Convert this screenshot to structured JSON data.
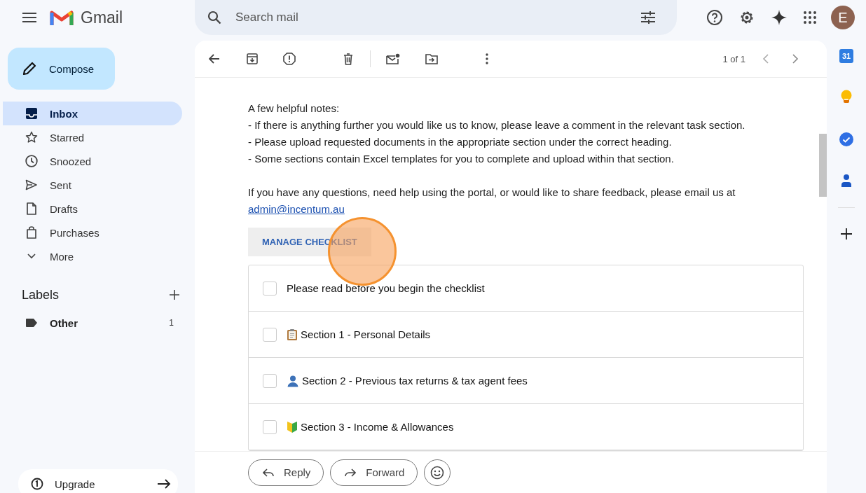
{
  "header": {
    "app_name": "Gmail",
    "search": {
      "placeholder": "Search mail"
    },
    "avatar": "E"
  },
  "compose": "Compose",
  "nav": [
    {
      "label": "Inbox",
      "kind": "inbox",
      "selected": true
    },
    {
      "label": "Starred",
      "kind": "star",
      "selected": false
    },
    {
      "label": "Snoozed",
      "kind": "clock",
      "selected": false
    },
    {
      "label": "Sent",
      "kind": "send",
      "selected": false
    },
    {
      "label": "Drafts",
      "kind": "file",
      "selected": false
    },
    {
      "label": "Purchases",
      "kind": "bag",
      "selected": false
    },
    {
      "label": "More",
      "kind": "more",
      "selected": false
    }
  ],
  "labels": {
    "title": "Labels",
    "items": [
      {
        "name": "Other",
        "count": "1"
      }
    ]
  },
  "upgrade": "Upgrade",
  "toolbar": {
    "pager": "1 of 1"
  },
  "message": {
    "notes_title": "A few helpful notes:",
    "notes": [
      "- If there is anything further you would like us to know, please leave a comment in the relevant task section.",
      "- Please upload requested documents in the appropriate section under the correct heading.",
      "- Some sections contain Excel templates for you to complete and upload within that section."
    ],
    "contact": "If you have any questions, need help using the portal, or would like to share feedback, please email us at",
    "email": "admin@incentum.au",
    "manage_button": "MANAGE CHECKLIST",
    "checklist": [
      {
        "label": "Please read before you begin the checklist",
        "kind": "plain",
        "checked": false
      },
      {
        "label": "Section 1 - Personal Details",
        "kind": "clipboard",
        "checked": false
      },
      {
        "label": "Section 2 - Previous tax returns & tax agent fees",
        "kind": "person",
        "checked": false
      },
      {
        "label": "Section 3 - Income & Allowances",
        "kind": "badge",
        "checked": false
      }
    ]
  },
  "actions": {
    "reply": "Reply",
    "forward": "Forward"
  },
  "rail": {
    "calendar_day": "31"
  }
}
